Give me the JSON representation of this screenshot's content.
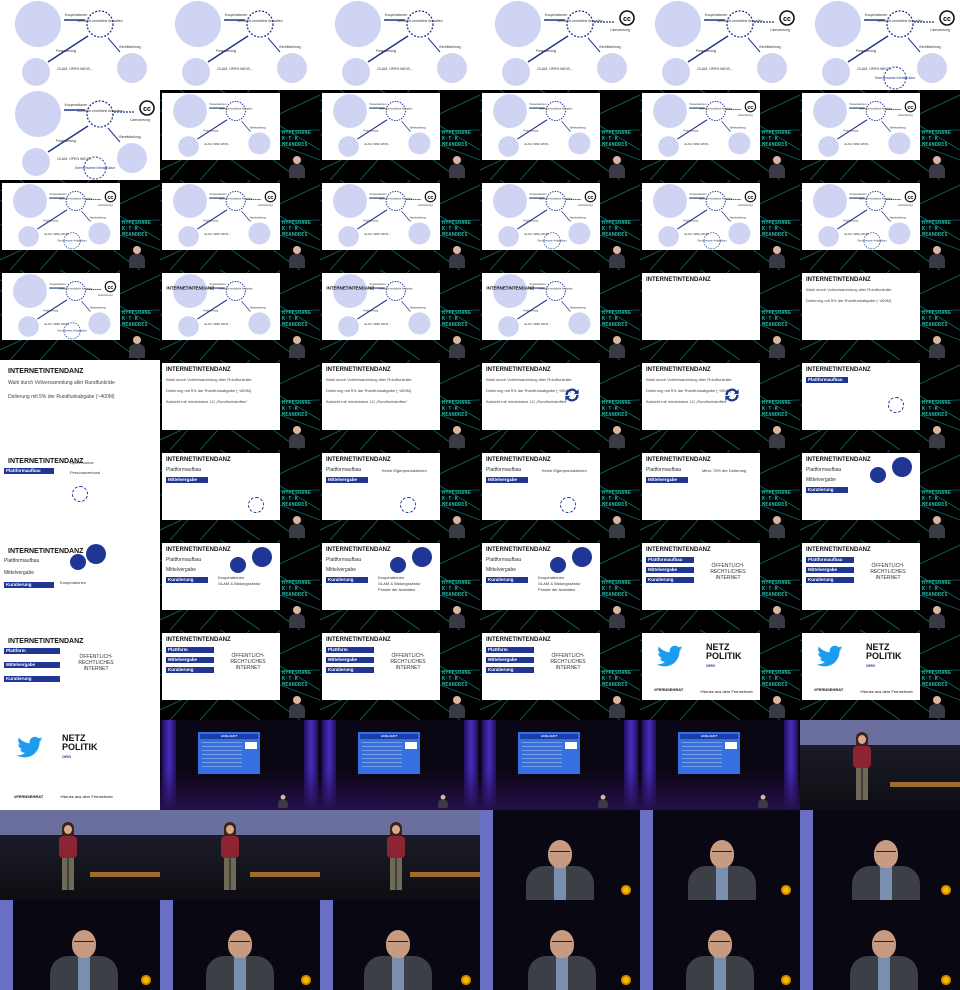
{
  "colors": {
    "accent_blue": "#1f3694",
    "teal_brand": "#1fb7a6",
    "pale_circle": "#cfd4f2",
    "stage_bg": "#000000",
    "twitter_blue": "#1d9bf0"
  },
  "diagram": {
    "label_kooperationen": "Kooperationen",
    "label_oer": "öffentlich-rechtliche Anstalten",
    "label_lizenzierung": "Lizenzierung",
    "label_finanzierung": "Finanzierung",
    "label_bereitstellung": "Bereitstellung",
    "label_bottom": "GLAM, OPEN WIKIS...",
    "label_commons": "Gemeinsame Infrastruktur",
    "cc": "cc"
  },
  "brand": {
    "lines": [
      "HYPESHANG",
      "K·T·K",
      "MEANDRES"
    ]
  },
  "slides": {
    "title": "INTERNETINTENDANZ",
    "wahl": "Wahl durch Vollversammlung aller Rundfunkräte",
    "dotierung": "Dotierung mit 5% der Rundfunkabgabe (~400M)",
    "aufsicht": "Aufsicht mit mindestens 1G „Rundfunkstoffen“",
    "plattformaufbau": "Plattformaufbau",
    "plattform": "Plattform",
    "mittelvergabe": "Mittelvergabe",
    "kuratierung": "Kuratierung",
    "open_source": "Open Source",
    "personalverbund": "Personalverbund",
    "keine_eigen": "Keine Eigenproduktionen",
    "mind75": "Mind. 75% der Dotierung",
    "kooperationen": "Kooperationen",
    "glam": "GLAM & Bildungssektor",
    "portale": "Portale der Anstalten",
    "oer_internet": "ÖFFENTLICH-RECHTLICHES INTERNET",
    "oer_internet_hyph": "ÖFFENTLICH-\nRECHTLICHES\nINTERNET",
    "hashtag": "#FERNSEHRAT",
    "netzpolitik_main": "NETZ\nPOLITIK",
    "netzpolitik_org": "ORG",
    "neues": "»Neues aus dem Fernsehrat«"
  },
  "stage": {
    "screen_title": "AUSLAUFT"
  }
}
